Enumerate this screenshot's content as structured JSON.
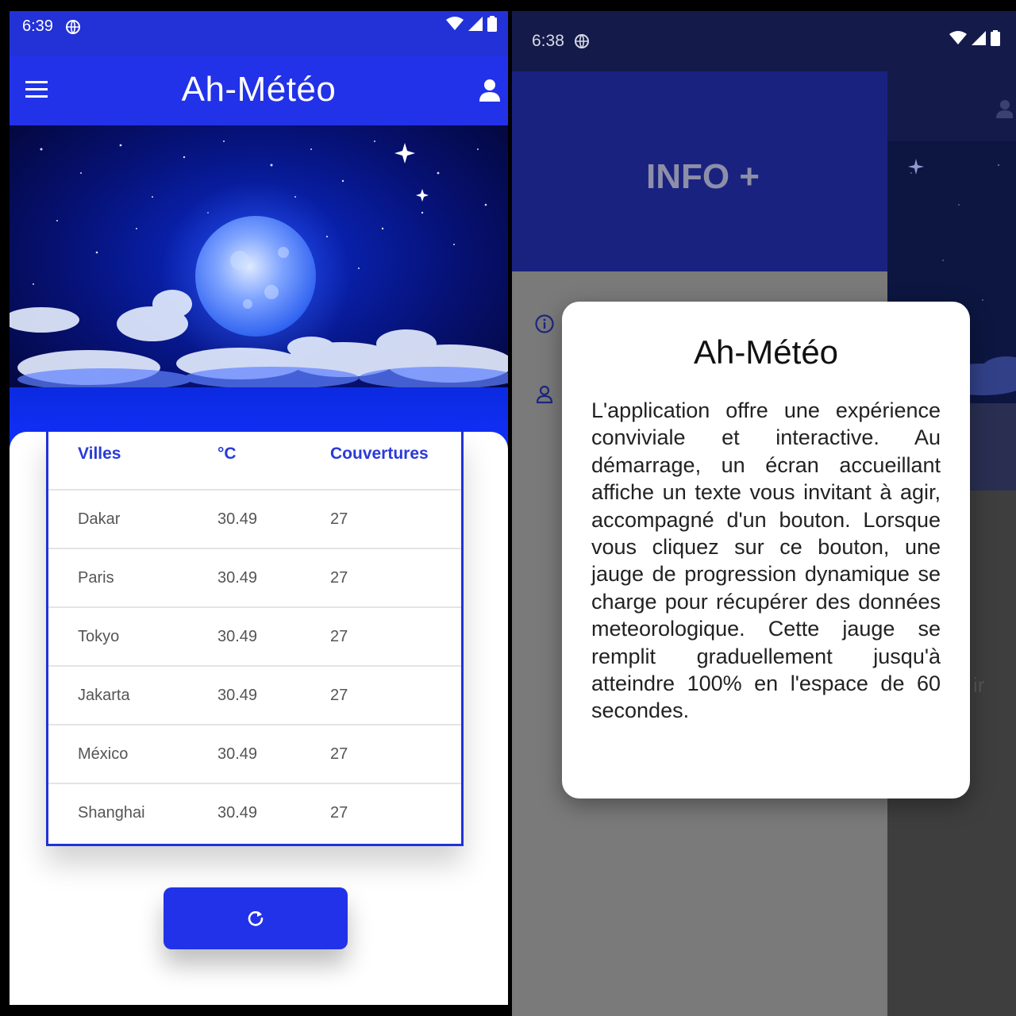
{
  "left_screen": {
    "status_bar": {
      "time": "6:39"
    },
    "app_bar": {
      "title": "Ah-Météo"
    },
    "table": {
      "headers": [
        "Villes",
        "°C",
        "Couvertures"
      ],
      "rows": [
        [
          "Dakar",
          "30.49",
          "27"
        ],
        [
          "Paris",
          "30.49",
          "27"
        ],
        [
          "Tokyo",
          "30.49",
          "27"
        ],
        [
          "Jakarta",
          "30.49",
          "27"
        ],
        [
          "México",
          "30.49",
          "27"
        ],
        [
          "Shanghai",
          "30.49",
          "27"
        ]
      ]
    },
    "refresh_button": {
      "icon": "refresh-icon"
    },
    "colors": {
      "primary": "#2232e8",
      "status_bar": "#2232d6",
      "header_text": "#2a3ad8"
    }
  },
  "right_screen": {
    "status_bar": {
      "time": "6:38"
    },
    "drawer": {
      "title": "INFO +",
      "items": [
        {
          "icon": "info-icon"
        },
        {
          "icon": "person-icon"
        }
      ]
    },
    "dialog": {
      "title": "Ah-Météo",
      "body": "L'application offre une expérience conviviale et interactive. Au démarrage, un écran accueillant affiche un texte vous invitant à agir, accompagné d'un bouton. Lorsque vous cliquez sur ce bouton, une jauge de progression dynamique se charge pour récupérer des données meteorologique. Cette jauge se remplit graduellement jusqu'à atteindre 100% en l'espace de 60 secondes."
    },
    "background_fragment": "ir"
  }
}
